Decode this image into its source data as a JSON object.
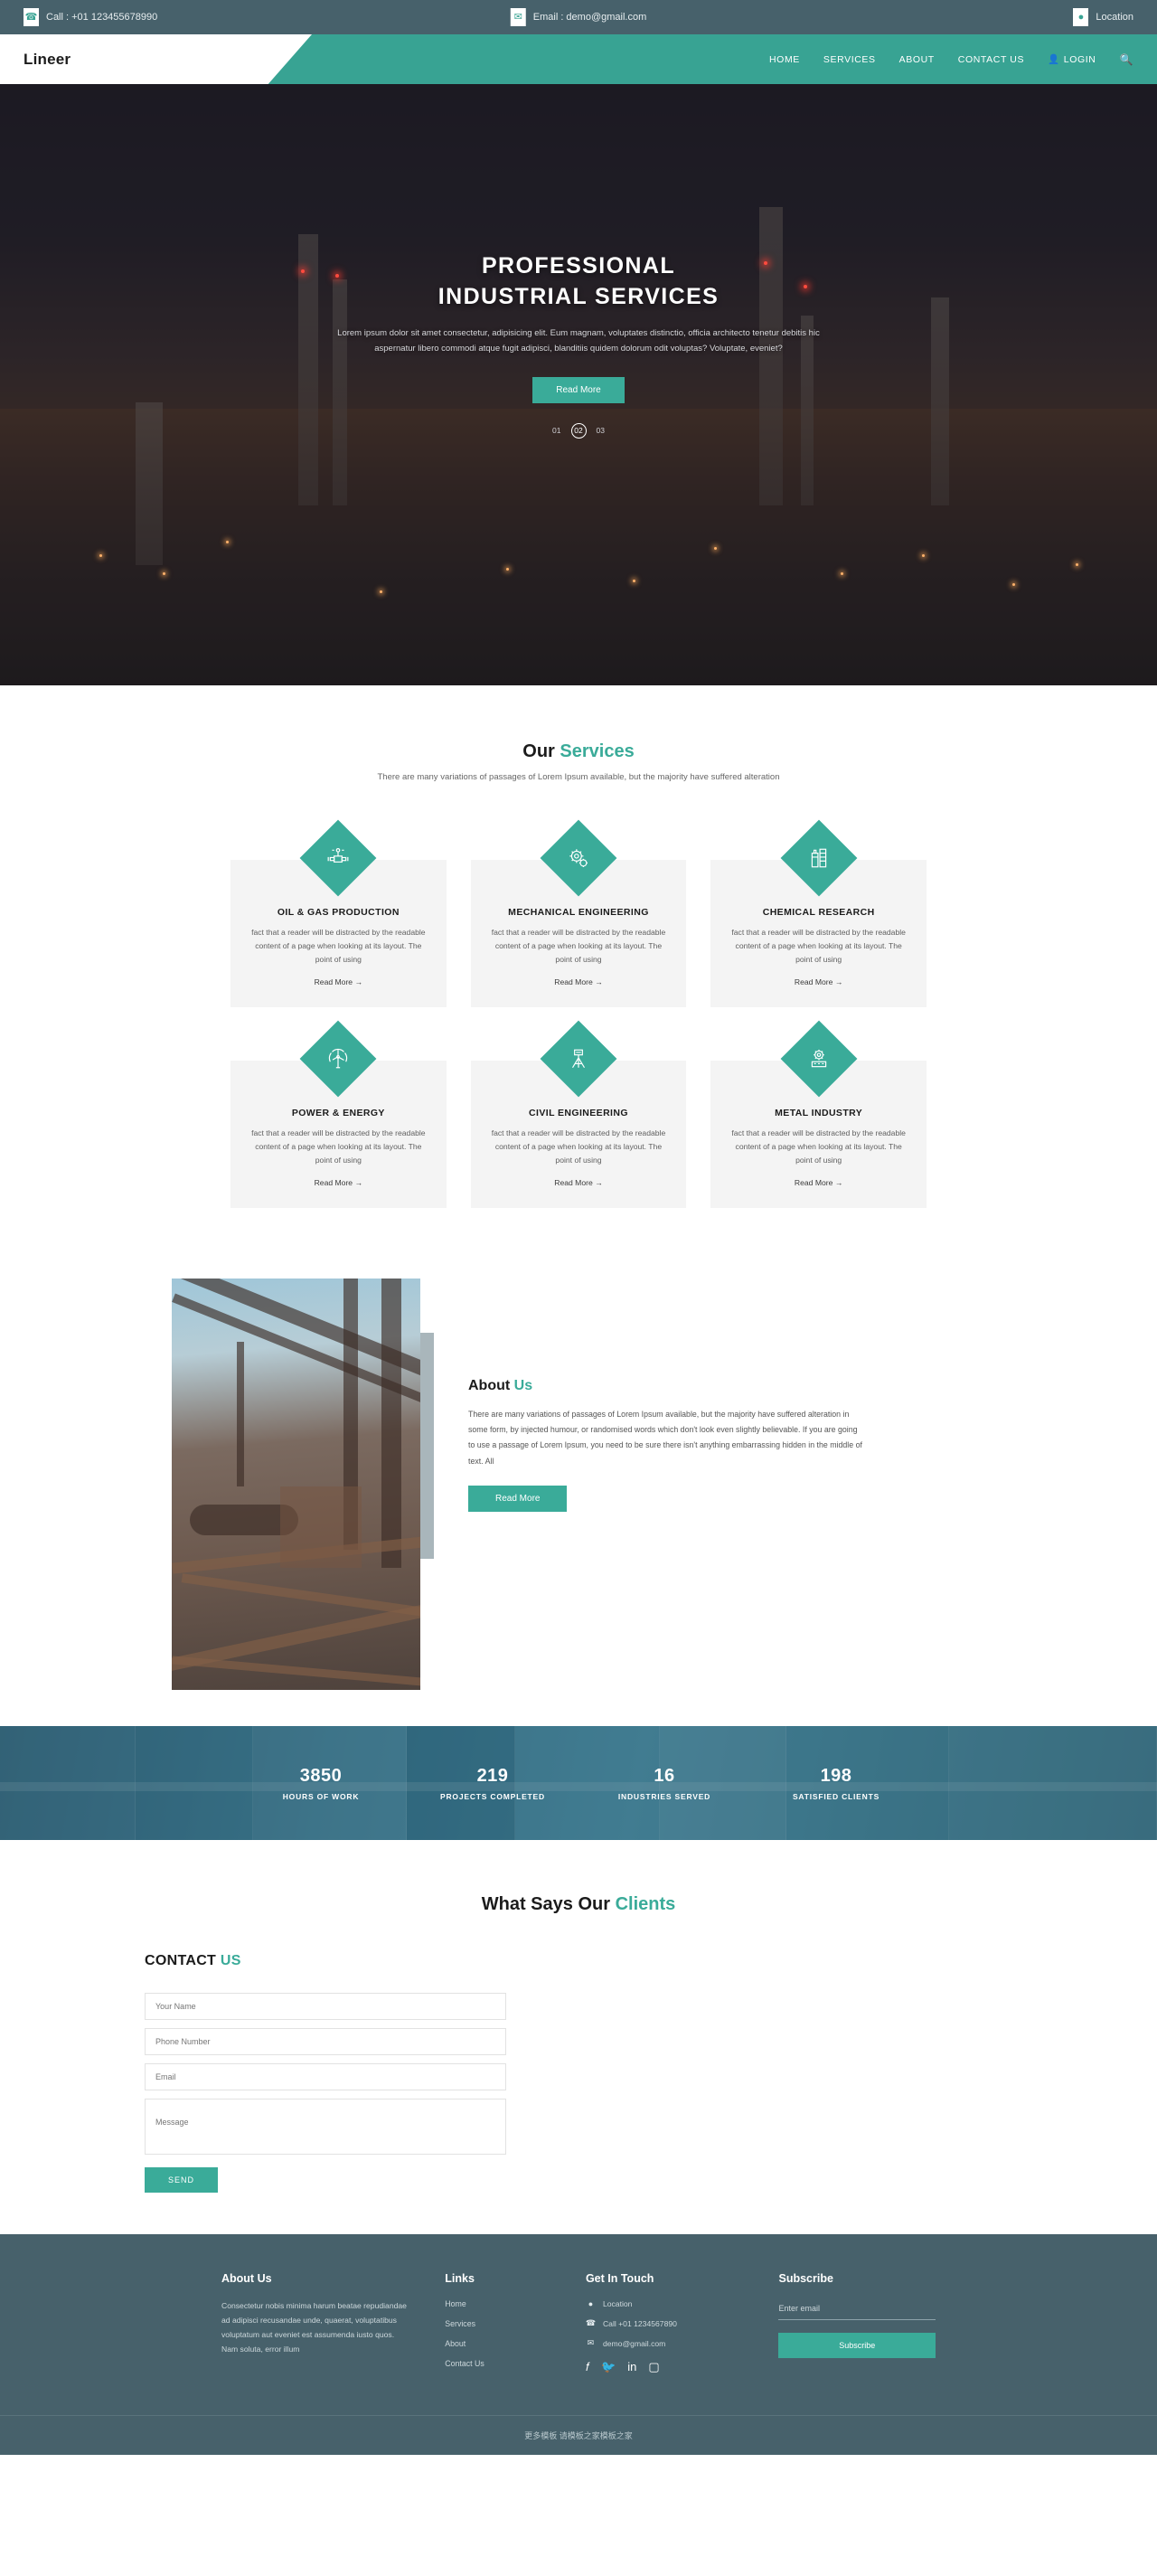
{
  "topbar": {
    "phone": "Call : +01 123455678990",
    "email": "Email : demo@gmail.com",
    "location": "Location"
  },
  "nav": {
    "logo": "Lineer",
    "items": [
      {
        "label": "HOME"
      },
      {
        "label": "SERVICES"
      },
      {
        "label": "ABOUT"
      },
      {
        "label": "CONTACT US"
      },
      {
        "label": "LOGIN"
      }
    ],
    "search_icon": "search-icon"
  },
  "hero": {
    "title_line1": "PROFESSIONAL",
    "title_line2": "INDUSTRIAL SERVICES",
    "paragraph": "Lorem ipsum dolor sit amet consectetur, adipisicing elit. Eum magnam, voluptates distinctio, officia architecto tenetur debitis hic aspernatur libero commodi atque fugit adipisci, blanditiis quidem dolorum odit voluptas? Voluptate, eveniet?",
    "cta": "Read More",
    "slides": [
      "01",
      "02",
      "03"
    ],
    "active_slide": "02"
  },
  "services": {
    "title_main": "Our ",
    "title_accent": "Services",
    "subtitle": "There are many variations of passages of Lorem Ipsum available, but the majority have suffered alteration",
    "read_more": "Read More →",
    "cards": [
      {
        "name": "OIL & GAS PRODUCTION",
        "icon": "valve-icon",
        "desc": "fact that a reader will be distracted by the readable content of a page when looking at its layout. The point of using"
      },
      {
        "name": "MECHANICAL ENGINEERING",
        "icon": "gear-icon",
        "desc": "fact that a reader will be distracted by the readable content of a page when looking at its layout. The point of using"
      },
      {
        "name": "CHEMICAL RESEARCH",
        "icon": "flask-icon",
        "desc": "fact that a reader will be distracted by the readable content of a page when looking at its layout. The point of using"
      },
      {
        "name": "POWER & ENERGY",
        "icon": "wind-turbine-icon",
        "desc": "fact that a reader will be distracted by the readable content of a page when looking at its layout. The point of using"
      },
      {
        "name": "CIVIL ENGINEERING",
        "icon": "survey-tripod-icon",
        "desc": "fact that a reader will be distracted by the readable content of a page when looking at its layout. The point of using"
      },
      {
        "name": "METAL INDUSTRY",
        "icon": "cog-machine-icon",
        "desc": "fact that a reader will be distracted by the readable content of a page when looking at its layout. The point of using"
      }
    ]
  },
  "about": {
    "title_main": "About ",
    "title_accent": "Us",
    "body": "There are many variations of passages of Lorem Ipsum available, but the majority have suffered alteration in some form, by injected humour, or randomised words which don't look even slightly believable. If you are going to use a passage of Lorem Ipsum, you need to be sure there isn't anything embarrassing hidden in the middle of text. All",
    "cta": "Read More"
  },
  "stats": [
    {
      "value": "3850",
      "label": "HOURS OF WORK"
    },
    {
      "value": "219",
      "label": "PROJECTS COMPLETED"
    },
    {
      "value": "16",
      "label": "INDUSTRIES SERVED"
    },
    {
      "value": "198",
      "label": "SATISFIED CLIENTS"
    }
  ],
  "testimonials": {
    "title_main": "What Says Our ",
    "title_accent": "Clients"
  },
  "contact": {
    "title_main": "CONTACT ",
    "title_accent": "US",
    "name_placeholder": "Your Name",
    "phone_placeholder": "Phone Number",
    "email_placeholder": "Email",
    "message_placeholder": "Message",
    "send_label": "SEND"
  },
  "footer": {
    "about": {
      "heading": "About Us",
      "text": "Consectetur nobis minima harum beatae repudiandae ad adipisci recusandae unde, quaerat, voluptatibus voluptatum aut eveniet est assumenda iusto quos. Nam soluta, error illum"
    },
    "links": {
      "heading": "Links",
      "items": [
        {
          "label": "Home"
        },
        {
          "label": "Services"
        },
        {
          "label": "About"
        },
        {
          "label": "Contact Us"
        }
      ]
    },
    "touch": {
      "heading": "Get In Touch",
      "location": "Location",
      "phone": "Call +01 1234567890",
      "email": "demo@gmail.com",
      "social": [
        "facebook-icon",
        "twitter-icon",
        "linkedin-icon",
        "instagram-icon"
      ]
    },
    "subscribe": {
      "heading": "Subscribe",
      "placeholder": "Enter email",
      "button": "Subscribe"
    },
    "bottom": "更多模板 请模板之家模板之家"
  },
  "colors": {
    "accent": "#3aab99",
    "dark": "#47616b",
    "card_bg": "#f4f4f4"
  }
}
